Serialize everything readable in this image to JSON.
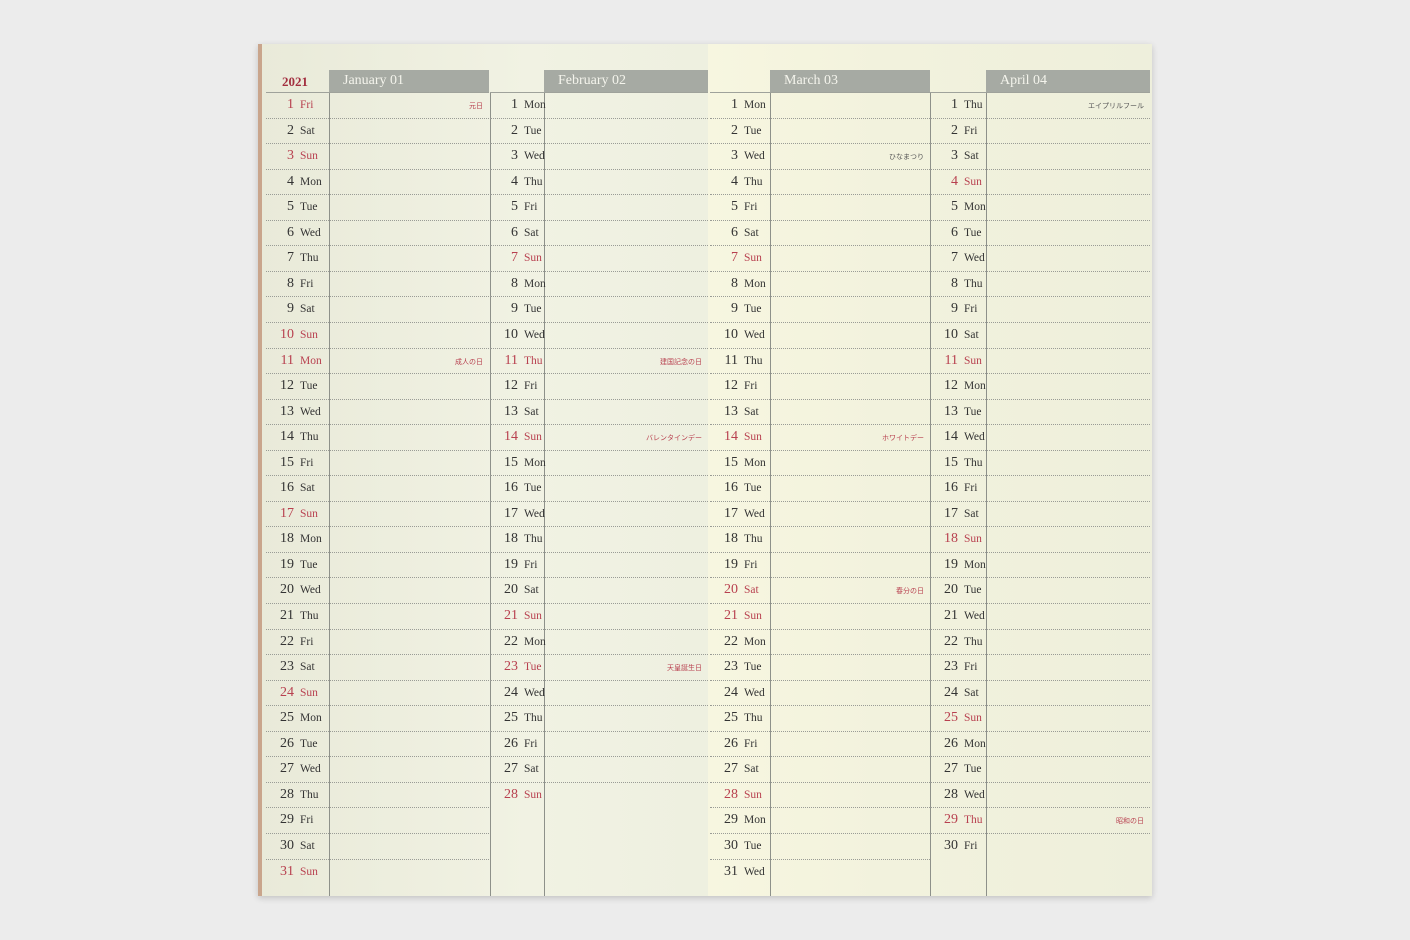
{
  "year": "2021",
  "months": [
    {
      "header": "January 01",
      "days": [
        [
          "1",
          "Fri",
          1
        ],
        [
          "2",
          "Sat",
          0
        ],
        [
          "3",
          "Sun",
          1
        ],
        [
          "4",
          "Mon",
          0
        ],
        [
          "5",
          "Tue",
          0
        ],
        [
          "6",
          "Wed",
          0
        ],
        [
          "7",
          "Thu",
          0
        ],
        [
          "8",
          "Fri",
          0
        ],
        [
          "9",
          "Sat",
          0
        ],
        [
          "10",
          "Sun",
          1
        ],
        [
          "11",
          "Mon",
          1
        ],
        [
          "12",
          "Tue",
          0
        ],
        [
          "13",
          "Wed",
          0
        ],
        [
          "14",
          "Thu",
          0
        ],
        [
          "15",
          "Fri",
          0
        ],
        [
          "16",
          "Sat",
          0
        ],
        [
          "17",
          "Sun",
          1
        ],
        [
          "18",
          "Mon",
          0
        ],
        [
          "19",
          "Tue",
          0
        ],
        [
          "20",
          "Wed",
          0
        ],
        [
          "21",
          "Thu",
          0
        ],
        [
          "22",
          "Fri",
          0
        ],
        [
          "23",
          "Sat",
          0
        ],
        [
          "24",
          "Sun",
          1
        ],
        [
          "25",
          "Mon",
          0
        ],
        [
          "26",
          "Tue",
          0
        ],
        [
          "27",
          "Wed",
          0
        ],
        [
          "28",
          "Thu",
          0
        ],
        [
          "29",
          "Fri",
          0
        ],
        [
          "30",
          "Sat",
          0
        ],
        [
          "31",
          "Sun",
          1
        ]
      ],
      "notes": [
        {
          "day": 1,
          "text": "元日",
          "red": true
        },
        {
          "day": 11,
          "text": "成人の日",
          "red": true
        }
      ]
    },
    {
      "header": "February 02",
      "days": [
        [
          "1",
          "Mon",
          0
        ],
        [
          "2",
          "Tue",
          0
        ],
        [
          "3",
          "Wed",
          0
        ],
        [
          "4",
          "Thu",
          0
        ],
        [
          "5",
          "Fri",
          0
        ],
        [
          "6",
          "Sat",
          0
        ],
        [
          "7",
          "Sun",
          1
        ],
        [
          "8",
          "Mon",
          0
        ],
        [
          "9",
          "Tue",
          0
        ],
        [
          "10",
          "Wed",
          0
        ],
        [
          "11",
          "Thu",
          1
        ],
        [
          "12",
          "Fri",
          0
        ],
        [
          "13",
          "Sat",
          0
        ],
        [
          "14",
          "Sun",
          1
        ],
        [
          "15",
          "Mon",
          0
        ],
        [
          "16",
          "Tue",
          0
        ],
        [
          "17",
          "Wed",
          0
        ],
        [
          "18",
          "Thu",
          0
        ],
        [
          "19",
          "Fri",
          0
        ],
        [
          "20",
          "Sat",
          0
        ],
        [
          "21",
          "Sun",
          1
        ],
        [
          "22",
          "Mon",
          0
        ],
        [
          "23",
          "Tue",
          1
        ],
        [
          "24",
          "Wed",
          0
        ],
        [
          "25",
          "Thu",
          0
        ],
        [
          "26",
          "Fri",
          0
        ],
        [
          "27",
          "Sat",
          0
        ],
        [
          "28",
          "Sun",
          1
        ]
      ],
      "notes": [
        {
          "day": 11,
          "text": "建国記念の日",
          "red": true
        },
        {
          "day": 14,
          "text": "バレンタインデー",
          "red": true
        },
        {
          "day": 23,
          "text": "天皇誕生日",
          "red": true
        }
      ]
    },
    {
      "header": "March 03",
      "days": [
        [
          "1",
          "Mon",
          0
        ],
        [
          "2",
          "Tue",
          0
        ],
        [
          "3",
          "Wed",
          0
        ],
        [
          "4",
          "Thu",
          0
        ],
        [
          "5",
          "Fri",
          0
        ],
        [
          "6",
          "Sat",
          0
        ],
        [
          "7",
          "Sun",
          1
        ],
        [
          "8",
          "Mon",
          0
        ],
        [
          "9",
          "Tue",
          0
        ],
        [
          "10",
          "Wed",
          0
        ],
        [
          "11",
          "Thu",
          0
        ],
        [
          "12",
          "Fri",
          0
        ],
        [
          "13",
          "Sat",
          0
        ],
        [
          "14",
          "Sun",
          1
        ],
        [
          "15",
          "Mon",
          0
        ],
        [
          "16",
          "Tue",
          0
        ],
        [
          "17",
          "Wed",
          0
        ],
        [
          "18",
          "Thu",
          0
        ],
        [
          "19",
          "Fri",
          0
        ],
        [
          "20",
          "Sat",
          1
        ],
        [
          "21",
          "Sun",
          1
        ],
        [
          "22",
          "Mon",
          0
        ],
        [
          "23",
          "Tue",
          0
        ],
        [
          "24",
          "Wed",
          0
        ],
        [
          "25",
          "Thu",
          0
        ],
        [
          "26",
          "Fri",
          0
        ],
        [
          "27",
          "Sat",
          0
        ],
        [
          "28",
          "Sun",
          1
        ],
        [
          "29",
          "Mon",
          0
        ],
        [
          "30",
          "Tue",
          0
        ],
        [
          "31",
          "Wed",
          0
        ]
      ],
      "notes": [
        {
          "day": 3,
          "text": "ひなまつり",
          "red": false
        },
        {
          "day": 14,
          "text": "ホワイトデー",
          "red": true
        },
        {
          "day": 20,
          "text": "春分の日",
          "red": true
        }
      ]
    },
    {
      "header": "April 04",
      "days": [
        [
          "1",
          "Thu",
          0
        ],
        [
          "2",
          "Fri",
          0
        ],
        [
          "3",
          "Sat",
          0
        ],
        [
          "4",
          "Sun",
          1
        ],
        [
          "5",
          "Mon",
          0
        ],
        [
          "6",
          "Tue",
          0
        ],
        [
          "7",
          "Wed",
          0
        ],
        [
          "8",
          "Thu",
          0
        ],
        [
          "9",
          "Fri",
          0
        ],
        [
          "10",
          "Sat",
          0
        ],
        [
          "11",
          "Sun",
          1
        ],
        [
          "12",
          "Mon",
          0
        ],
        [
          "13",
          "Tue",
          0
        ],
        [
          "14",
          "Wed",
          0
        ],
        [
          "15",
          "Thu",
          0
        ],
        [
          "16",
          "Fri",
          0
        ],
        [
          "17",
          "Sat",
          0
        ],
        [
          "18",
          "Sun",
          1
        ],
        [
          "19",
          "Mon",
          0
        ],
        [
          "20",
          "Tue",
          0
        ],
        [
          "21",
          "Wed",
          0
        ],
        [
          "22",
          "Thu",
          0
        ],
        [
          "23",
          "Fri",
          0
        ],
        [
          "24",
          "Sat",
          0
        ],
        [
          "25",
          "Sun",
          1
        ],
        [
          "26",
          "Mon",
          0
        ],
        [
          "27",
          "Tue",
          0
        ],
        [
          "28",
          "Wed",
          0
        ],
        [
          "29",
          "Thu",
          1
        ],
        [
          "30",
          "Fri",
          0
        ]
      ],
      "notes": [
        {
          "day": 1,
          "text": "エイプリルフール",
          "red": false
        },
        {
          "day": 29,
          "text": "昭和の日",
          "red": true
        }
      ]
    }
  ],
  "colors": {
    "header_bg": "#a6aaa3",
    "holiday": "#b8404f",
    "paper": "#eeefe0"
  }
}
